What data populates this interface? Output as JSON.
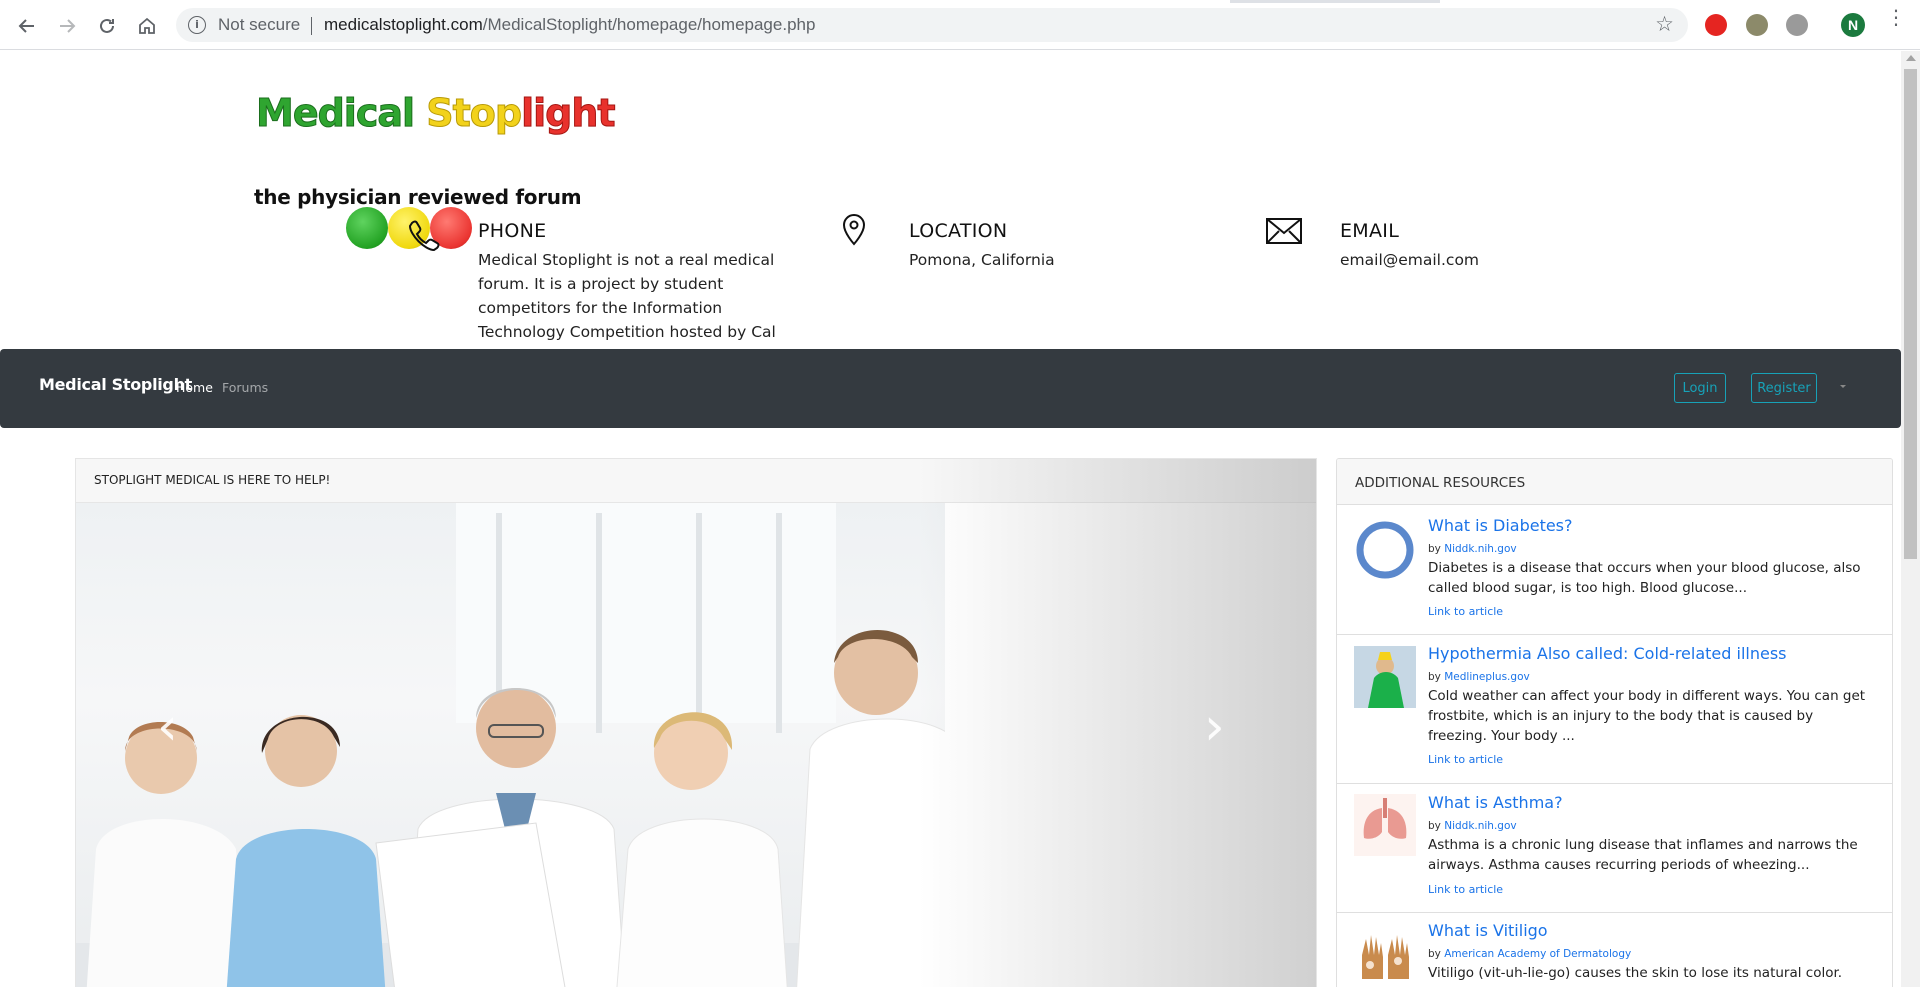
{
  "browser": {
    "security_label": "Not secure",
    "url_host": "medicalstoplight.com",
    "url_path": "/MedicalStoplight/homepage/homepage.php",
    "profile_initial": "N"
  },
  "header": {
    "logo_line1_green": "Medical ",
    "logo_line1_yellow": "Stop",
    "logo_line1_red": "light",
    "logo_line2": "the physician reviewed forum",
    "phone": {
      "title": "PHONE",
      "text": "Medical Stoplight is not a real medical forum. It is a project by student competitors for the Information Technology Competition hosted by Cal Poly Pomona's MISSA."
    },
    "location": {
      "title": "LOCATION",
      "text": "Pomona, California"
    },
    "email": {
      "title": "EMAIL",
      "text": "email@email.com"
    }
  },
  "navbar": {
    "brand": "Medical Stoplight",
    "links": [
      "Home",
      "Forums"
    ],
    "login": "Login",
    "register": "Register"
  },
  "carousel": {
    "caption": "STOPLIGHT MEDICAL IS HERE TO HELP!",
    "prev": "‹",
    "next": "›"
  },
  "sidebar": {
    "title": "ADDITIONAL RESOURCES",
    "items": [
      {
        "title": "What is Diabetes?",
        "by": "by ",
        "source": "Niddk.nih.gov",
        "desc": "Diabetes is a disease that occurs when your blood glucose, also called blood sugar, is too high. Blood glucose...",
        "link": "Link to article"
      },
      {
        "title": "Hypothermia Also called: Cold-related illness",
        "by": "by ",
        "source": "Medlineplus.gov",
        "desc": "Cold weather can affect your body in different ways. You can get frostbite, which is an injury to the body that is caused by freezing. Your body ...",
        "link": "Link to article"
      },
      {
        "title": "What is Asthma?",
        "by": "by ",
        "source": "Niddk.nih.gov",
        "desc": "Asthma is a chronic lung disease that inflames and narrows the airways. Asthma causes recurring periods of wheezing...",
        "link": "Link to article"
      },
      {
        "title": "What is Vitiligo",
        "by": "by ",
        "source": "American Academy of Dermatology",
        "desc": "Vitiligo (vit-uh-lie-go) causes the skin to lose its natural color. Patches of",
        "link": ""
      }
    ]
  }
}
